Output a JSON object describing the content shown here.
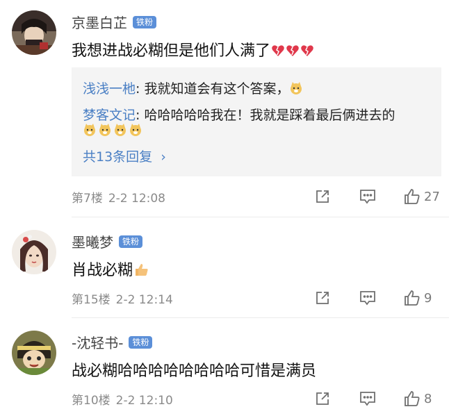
{
  "comments": [
    {
      "username": "京墨白芷",
      "badge": "铁粉",
      "content": "我想进战必糊但是他们人满了",
      "content_emojis": [
        "broken-heart",
        "broken-heart",
        "broken-heart"
      ],
      "replies": [
        {
          "name": "浅浅一杝",
          "sep": ": ",
          "text": "我就知道会有这个答案，",
          "emojis": [
            "doge"
          ]
        },
        {
          "name": "梦客文记",
          "sep": ": ",
          "text": "哈哈哈哈哈我在！我就是踩着最后俩进去的",
          "emojis": [
            "doge",
            "doge",
            "doge",
            "doge"
          ]
        }
      ],
      "more_replies": "共13条回复",
      "more_chevron": "›",
      "floor": "第7楼",
      "time": "2-2 12:08",
      "likes": "27"
    },
    {
      "username": "墨曦梦",
      "badge": "铁粉",
      "content": "肖战必糊",
      "content_emojis": [
        "thumbs-up"
      ],
      "floor": "第15楼",
      "time": "2-2 12:14",
      "likes": "9"
    },
    {
      "username": "-沈轻书-",
      "badge": "铁粉",
      "content": "战必糊哈哈哈哈哈哈哈哈可惜是满员",
      "floor": "第10楼",
      "time": "2-2 12:10",
      "likes": "8"
    }
  ],
  "colors": {
    "badge": "#5b8fd8",
    "reply_name": "#4a7fc4",
    "meta": "#8a8a8a",
    "reply_bg": "#f4f4f4"
  },
  "icons": [
    "share-icon",
    "comment-icon",
    "thumbs-up-icon"
  ]
}
